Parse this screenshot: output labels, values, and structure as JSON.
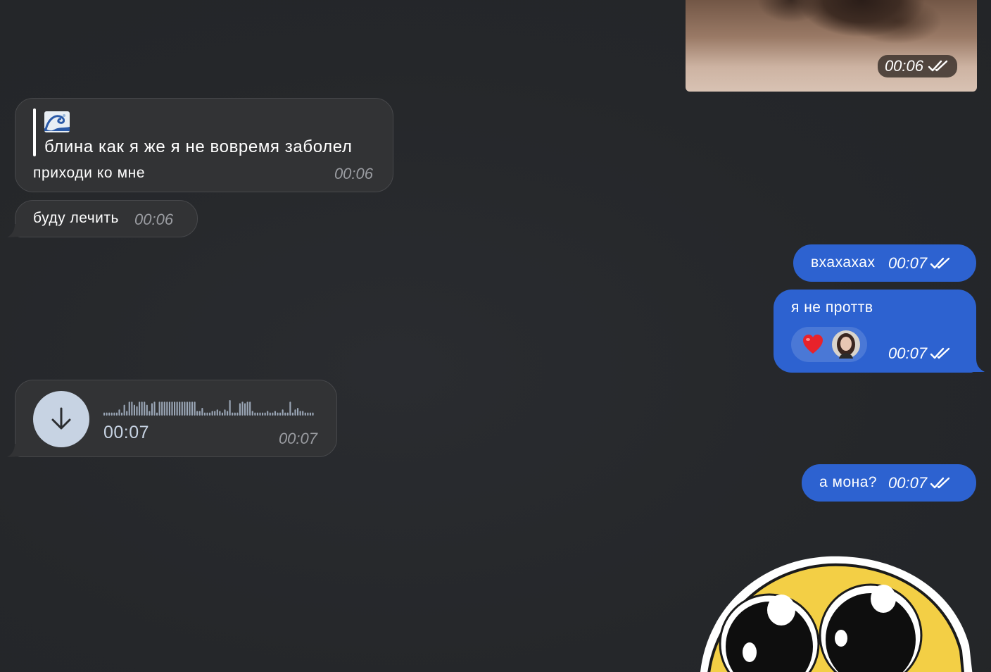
{
  "photo_message": {
    "time": "00:06",
    "status_icon": "double-check-icon"
  },
  "incoming": [
    {
      "reply": {
        "emoji": "wave-emoji",
        "quote_text": "блина как я же я не вовремя заболел"
      },
      "text": "приходи ко мне",
      "time": "00:06"
    },
    {
      "text": "буду лечить",
      "time": "00:06"
    }
  ],
  "voice_message": {
    "duration": "00:07",
    "time": "00:07",
    "button_icon": "download-arrow-icon"
  },
  "outgoing": [
    {
      "text": "вхахахах",
      "time": "00:07",
      "status_icon": "double-check-icon"
    },
    {
      "text": "я не проттв",
      "time": "00:07",
      "status_icon": "double-check-icon",
      "reaction": {
        "emoji": "heart-emoji",
        "avatar": "user-avatar"
      }
    },
    {
      "text": "а мона?",
      "time": "00:07",
      "status_icon": "double-check-icon"
    }
  ],
  "sticker": {
    "name": "pleading-face-sticker"
  },
  "colors": {
    "background": "#25272a",
    "incoming_bubble": "#323335",
    "outgoing_bubble": "#2d62d0",
    "voice_button": "#c7d3e3"
  }
}
